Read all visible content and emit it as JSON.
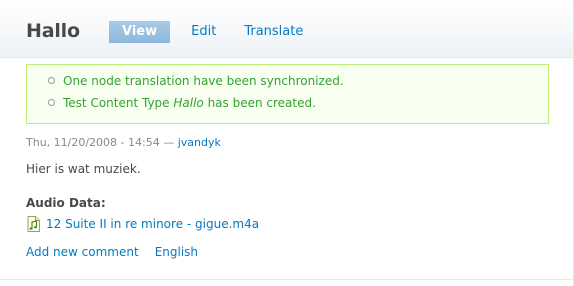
{
  "page": {
    "title": "Hallo"
  },
  "tabs": [
    {
      "label": "View",
      "active": true
    },
    {
      "label": "Edit",
      "active": false
    },
    {
      "label": "Translate",
      "active": false
    }
  ],
  "messages": {
    "items": [
      {
        "text": "One node translation have been synchronized."
      },
      {
        "prefix": "Test Content Type ",
        "emphasis": "Hallo",
        "suffix": " has been created."
      }
    ]
  },
  "node": {
    "submitted_date": "Thu, 11/20/2008 - 14:54",
    "submitted_separator": " — ",
    "author": "jvandyk",
    "body": "Hier is wat muziek.",
    "audio_label": "Audio Data:",
    "file_name": "12 Suite II in re minore - gigue.m4a",
    "file_icon": "audio-file-icon"
  },
  "links": {
    "add_comment": "Add new comment",
    "language": "English"
  },
  "colors": {
    "link": "#027ac6",
    "message_text": "#33a333",
    "message_border": "#bbee77",
    "active_tab": "#8db8dd"
  }
}
